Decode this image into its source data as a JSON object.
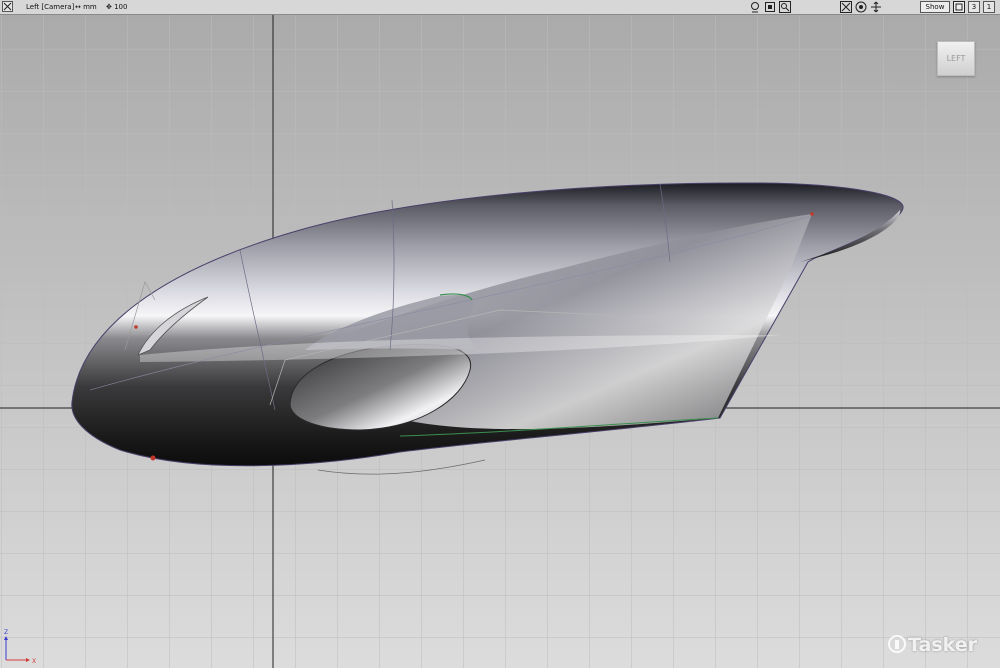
{
  "viewport": {
    "view_label": "Left [Camera]",
    "units_label": "mm",
    "zoom_value": "100",
    "view_cube_label": "LEFT",
    "axis_labels": {
      "x": "X",
      "z": "Z"
    }
  },
  "toolbar": {
    "show_label": "Show",
    "layout_single": "1",
    "layout_three": "3"
  },
  "watermark": "Tasker",
  "colors": {
    "background_top": "#a9a9a9",
    "background_bottom": "#dcdcdc",
    "grid_line": "#b8b8b8",
    "world_axis": "#202020",
    "curve_green": "#3a8f4e",
    "curve_red": "#c0392b"
  },
  "icons": [
    "grab-icon",
    "frame-icon",
    "magnify-icon",
    "perspective-icon",
    "orbit-icon",
    "zoom-fit-icon",
    "maximize-icon"
  ]
}
